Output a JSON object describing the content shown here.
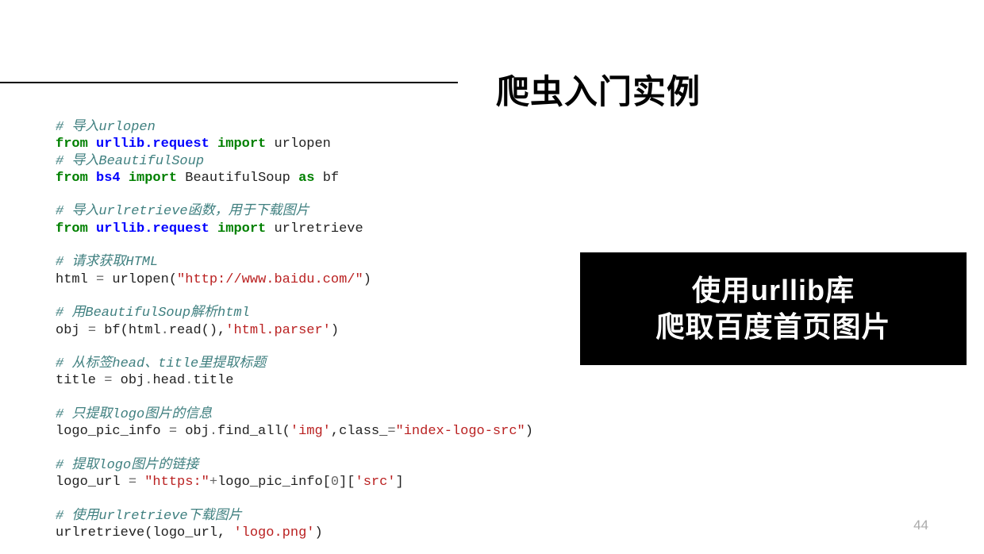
{
  "slide": {
    "title": "爬虫入门实例",
    "pageNumber": "44"
  },
  "sidebox": {
    "line1": "使用urllib库",
    "line2": "爬取百度首页图片"
  },
  "code": {
    "c1": "# 导入urlopen",
    "l2_from": "from",
    "l2_mod": "urllib.request",
    "l2_import": "import",
    "l2_name": "urlopen",
    "c3": "# 导入BeautifulSoup",
    "l4_from": "from",
    "l4_mod": "bs4",
    "l4_import": "import",
    "l4_name": "BeautifulSoup",
    "l4_as": "as",
    "l4_alias": "bf",
    "c5": "# 导入urlretrieve函数，用于下载图片",
    "l6_from": "from",
    "l6_mod": "urllib.request",
    "l6_import": "import",
    "l6_name": "urlretrieve",
    "c7": "# 请求获取HTML",
    "l8_lhs": "html",
    "l8_eq": "=",
    "l8_fn": "urlopen(",
    "l8_str": "\"http://www.baidu.com/\"",
    "l8_close": ")",
    "c9": "# 用BeautifulSoup解析html",
    "l10_lhs": "obj",
    "l10_eq": "=",
    "l10_fn": "bf(html",
    "l10_dot": ".",
    "l10_read": "read(),",
    "l10_str": "'html.parser'",
    "l10_close": ")",
    "c11": "# 从标签head、title里提取标题",
    "l12_lhs": "title",
    "l12_eq": "=",
    "l12_rhs1": "obj",
    "l12_dot1": ".",
    "l12_head": "head",
    "l12_dot2": ".",
    "l12_title": "title",
    "c13": "# 只提取logo图片的信息",
    "l14_lhs": "logo_pic_info",
    "l14_eq": "=",
    "l14_obj": "obj",
    "l14_dot": ".",
    "l14_fn": "find_all(",
    "l14_str1": "'img'",
    "l14_comma": ",class_",
    "l14_eq2": "=",
    "l14_str2": "\"index-logo-src\"",
    "l14_close": ")",
    "c15": "# 提取logo图片的链接",
    "l16_lhs": "logo_url",
    "l16_eq": "=",
    "l16_str1": "\"https:\"",
    "l16_plus": "+",
    "l16_rhs": "logo_pic_info[",
    "l16_idx": "0",
    "l16_br": "][",
    "l16_str2": "'src'",
    "l16_close": "]",
    "c17": "# 使用urlretrieve下载图片",
    "l18_fn": "urlretrieve(logo_url,",
    "l18_sp": " ",
    "l18_str": "'logo.png'",
    "l18_close": ")"
  }
}
